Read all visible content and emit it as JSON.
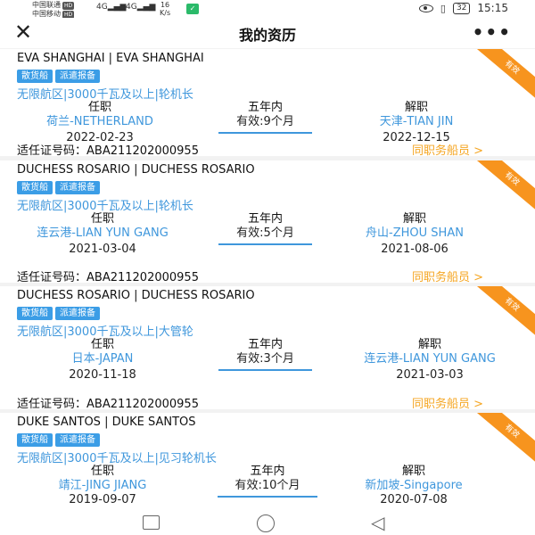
{
  "status_bar": {
    "carrier_1": "中国联通",
    "carrier_2": "中国移动",
    "hd_label": "HD",
    "signal_1": "4G",
    "signal_2": "4G",
    "speed_value": "16",
    "speed_unit": "K/s",
    "battery": "32",
    "time": "15:15"
  },
  "header": {
    "title": "我的资历",
    "close_icon": "close-icon",
    "more_icon": "more-icon"
  },
  "labels": {
    "start": "任职",
    "five_year": "五年内",
    "end": "解职",
    "cert_label": "适任证号码：",
    "peers": "同职务船员 >",
    "ribbon": "有效"
  },
  "records": [
    {
      "ship": "EVA SHANGHAI | EVA SHANGHAI",
      "tags": [
        "散货船",
        "派遣报备"
      ],
      "route": "无限航区|3000千瓦及以上|轮机长",
      "start_place": "荷兰-NETHERLAND",
      "start_date": "2022-02-23",
      "valid": "有效:9个月",
      "end_place": "天津-TIAN JIN",
      "end_date": "2022-12-15",
      "cert_no": "ABA211202000955"
    },
    {
      "ship": "DUCHESS ROSARIO | DUCHESS ROSARIO",
      "tags": [
        "散货船",
        "派遣报备"
      ],
      "route": "无限航区|3000千瓦及以上|轮机长",
      "start_place": "连云港-LIAN YUN GANG",
      "start_date": "2021-03-04",
      "valid": "有效:5个月",
      "end_place": "舟山-ZHOU SHAN",
      "end_date": "2021-08-06",
      "cert_no": "ABA211202000955"
    },
    {
      "ship": "DUCHESS ROSARIO | DUCHESS ROSARIO",
      "tags": [
        "散货船",
        "派遣报备"
      ],
      "route": "无限航区|3000千瓦及以上|大管轮",
      "start_place": "日本-JAPAN",
      "start_date": "2020-11-18",
      "valid": "有效:3个月",
      "end_place": "连云港-LIAN YUN GANG",
      "end_date": "2021-03-03",
      "cert_no": "ABA211202000955"
    },
    {
      "ship": "DUKE SANTOS | DUKE SANTOS",
      "tags": [
        "散货船",
        "派遣报备"
      ],
      "route": "无限航区|3000千瓦及以上|见习轮机长",
      "start_place": "靖江-JING JIANG",
      "start_date": "2019-09-07",
      "valid": "有效:10个月",
      "end_place": "新加坡-Singapore",
      "end_date": "2020-07-08",
      "cert_no": ""
    }
  ],
  "colors": {
    "accent_blue": "#3f97dc",
    "tag_blue": "#3b9de6",
    "ribbon_orange": "#f7941e",
    "link_orange": "#f5a623"
  }
}
